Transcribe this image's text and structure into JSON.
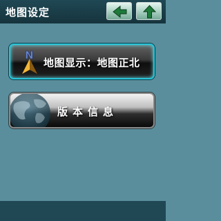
{
  "header": {
    "title": "地图设定",
    "back_icon": "arrow-left-icon",
    "up_icon": "arrow-up-icon"
  },
  "menu": {
    "map_display_label": "地图显示：地图正北",
    "map_display_icon": "north-compass-icon",
    "version_label": "版本信息",
    "version_icon": "globe-icon"
  },
  "colors": {
    "background": "#5a8e9c",
    "header": "#1f4854",
    "selected_border": "#28c5d8",
    "nav_arrow": "#1e7a3a"
  }
}
